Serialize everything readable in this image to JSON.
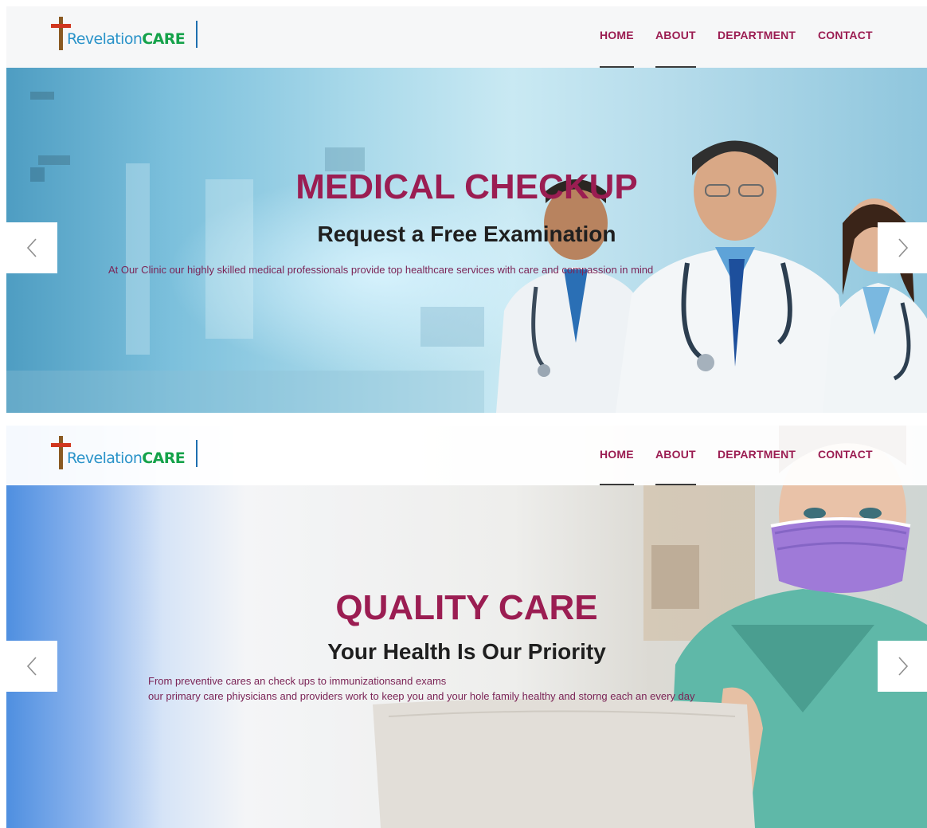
{
  "brand": {
    "logo_part1": "Revelation",
    "logo_part2": "CARE"
  },
  "nav": {
    "items": [
      {
        "label": "HOME"
      },
      {
        "label": "ABOUT"
      },
      {
        "label": "DEPARTMENT"
      },
      {
        "label": "CONTACT"
      }
    ]
  },
  "slides": [
    {
      "title": "MEDICAL CHECKUP",
      "subtitle": "Request a Free Examination",
      "lines": [
        "At Our Clinic our highly skilled medical professionals provide top healthcare services with care and compassion in mind"
      ]
    },
    {
      "title": "QUALITY CARE",
      "subtitle": "Your Health Is Our Priority",
      "lines": [
        "From preventive cares an check ups to immunizationsand exams",
        "our primary care phiysicians and providers work to keep you and your hole family healthy and storng each an every day"
      ]
    }
  ],
  "icons": {
    "prev": "chevron-left-icon",
    "next": "chevron-right-icon",
    "logo": "cross-icon"
  },
  "colors": {
    "accent": "#9b1d52",
    "heading": "#1f1f1f",
    "logo_blue": "#2a93c9",
    "logo_green": "#15a24a"
  }
}
